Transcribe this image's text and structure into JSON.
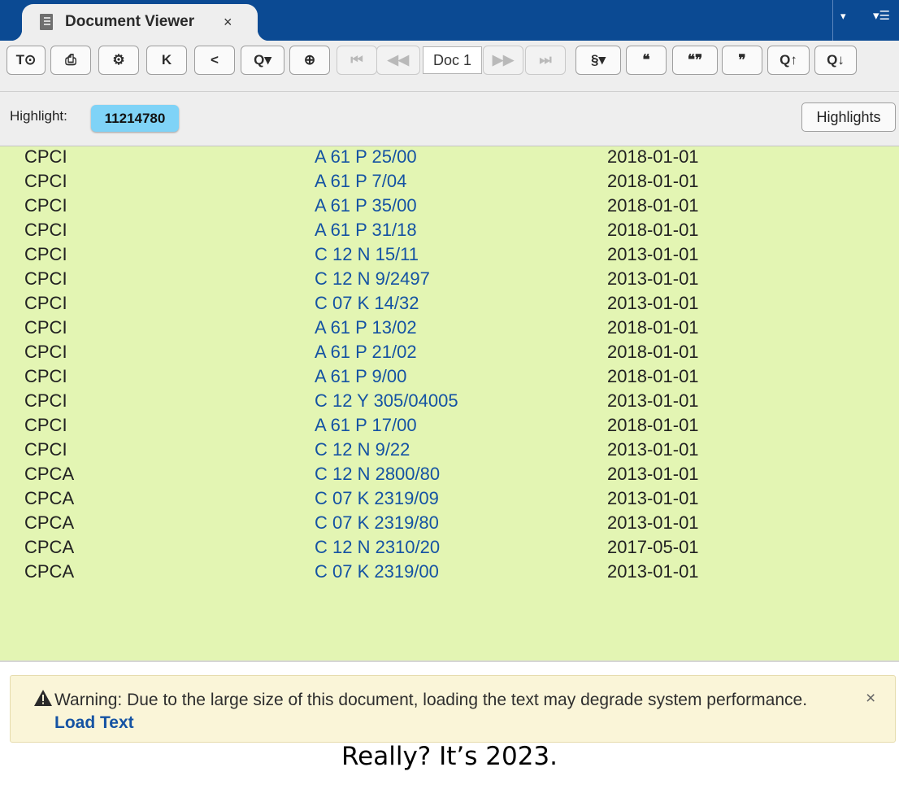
{
  "window": {
    "tab_title": "Document Viewer",
    "tab_close": "×",
    "menu_arrow": "▾",
    "menu_icon": "▾☰"
  },
  "toolbar": {
    "doc_label": "Doc 1",
    "buttons": [
      {
        "name": "text-view-button",
        "glyph": "T⊙",
        "disabled": false
      },
      {
        "name": "print-button",
        "glyph": "⎙",
        "disabled": false
      },
      {
        "name": "settings-button",
        "glyph": "⚙",
        "disabled": false
      },
      {
        "name": "kwic-button",
        "glyph": "K",
        "disabled": false
      },
      {
        "name": "share-button",
        "glyph": "<",
        "disabled": false
      },
      {
        "name": "search-dropdown-button",
        "glyph": "Q▾",
        "disabled": false
      },
      {
        "name": "zoom-button",
        "glyph": "⊕",
        "disabled": false
      },
      {
        "name": "first-doc-button",
        "glyph": "⏮",
        "disabled": true
      },
      {
        "name": "prev-doc-button",
        "glyph": "◀◀",
        "disabled": true
      },
      {
        "name": "next-doc-button",
        "glyph": "▶▶",
        "disabled": true
      },
      {
        "name": "last-doc-button",
        "glyph": "⏭",
        "disabled": true
      },
      {
        "name": "section-dropdown-button",
        "glyph": "§▾",
        "disabled": false
      },
      {
        "name": "open-quote-button",
        "glyph": "❝",
        "disabled": false
      },
      {
        "name": "both-quotes-button",
        "glyph": "❝❞",
        "disabled": false
      },
      {
        "name": "close-quote-button",
        "glyph": "❞",
        "disabled": false
      },
      {
        "name": "prev-hit-button",
        "glyph": "Q↑",
        "disabled": false
      },
      {
        "name": "next-hit-button",
        "glyph": "Q↓",
        "disabled": false
      }
    ]
  },
  "highlight": {
    "label": "Highlight:",
    "term": "11214780",
    "button_label": "Highlights"
  },
  "rows": [
    [
      "CPCI",
      "A 61 P 25/00",
      "2018-01-01"
    ],
    [
      "CPCI",
      "A 61 P 7/04",
      "2018-01-01"
    ],
    [
      "CPCI",
      "A 61 P 35/00",
      "2018-01-01"
    ],
    [
      "CPCI",
      "A 61 P 31/18",
      "2018-01-01"
    ],
    [
      "CPCI",
      "C 12 N 15/11",
      "2013-01-01"
    ],
    [
      "CPCI",
      "C 12 N 9/2497",
      "2013-01-01"
    ],
    [
      "CPCI",
      "C 07 K 14/32",
      "2013-01-01"
    ],
    [
      "CPCI",
      "A 61 P 13/02",
      "2018-01-01"
    ],
    [
      "CPCI",
      "A 61 P 21/02",
      "2018-01-01"
    ],
    [
      "CPCI",
      "A 61 P 9/00",
      "2018-01-01"
    ],
    [
      "CPCI",
      "C 12 Y 305/04005",
      "2013-01-01"
    ],
    [
      "CPCI",
      "A 61 P 17/00",
      "2018-01-01"
    ],
    [
      "CPCI",
      "C 12 N 9/22",
      "2013-01-01"
    ],
    [
      "CPCA",
      "C 12 N 2800/80",
      "2013-01-01"
    ],
    [
      "CPCA",
      "C 07 K 2319/09",
      "2013-01-01"
    ],
    [
      "CPCA",
      "C 07 K 2319/80",
      "2013-01-01"
    ],
    [
      "CPCA",
      "C 12 N 2310/20",
      "2017-05-01"
    ],
    [
      "CPCA",
      "C 07 K 2319/00",
      "2013-01-01"
    ]
  ],
  "warning": {
    "text": "Warning: Due to the large size of this document, loading the text may degrade system performance.",
    "link": "Load Text",
    "close": "×"
  },
  "caption": "Really?  It’s 2023."
}
